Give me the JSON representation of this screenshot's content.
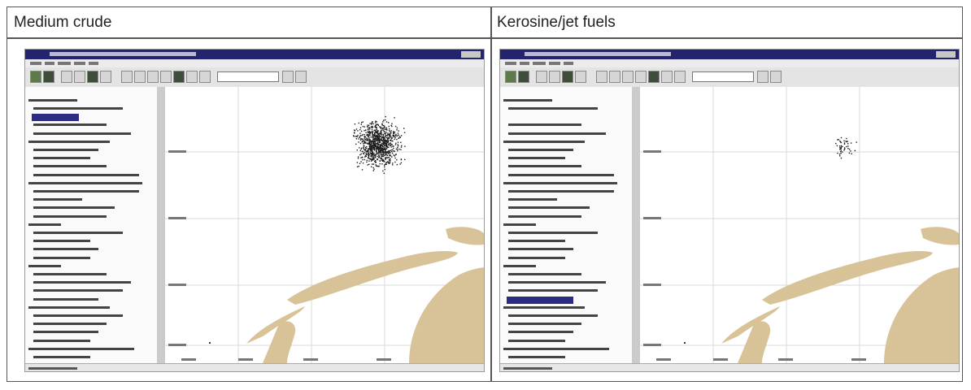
{
  "panels": [
    {
      "title": "Medium crude",
      "slick": "dense"
    },
    {
      "title": "Kerosine/jet fuels",
      "slick": "sparse"
    }
  ],
  "colors": {
    "land": "#d8c398",
    "grid": "#d8d8d8",
    "oil": "#1a1a1a",
    "titlebar": "#23236e",
    "highlight": "#2d2b82"
  }
}
